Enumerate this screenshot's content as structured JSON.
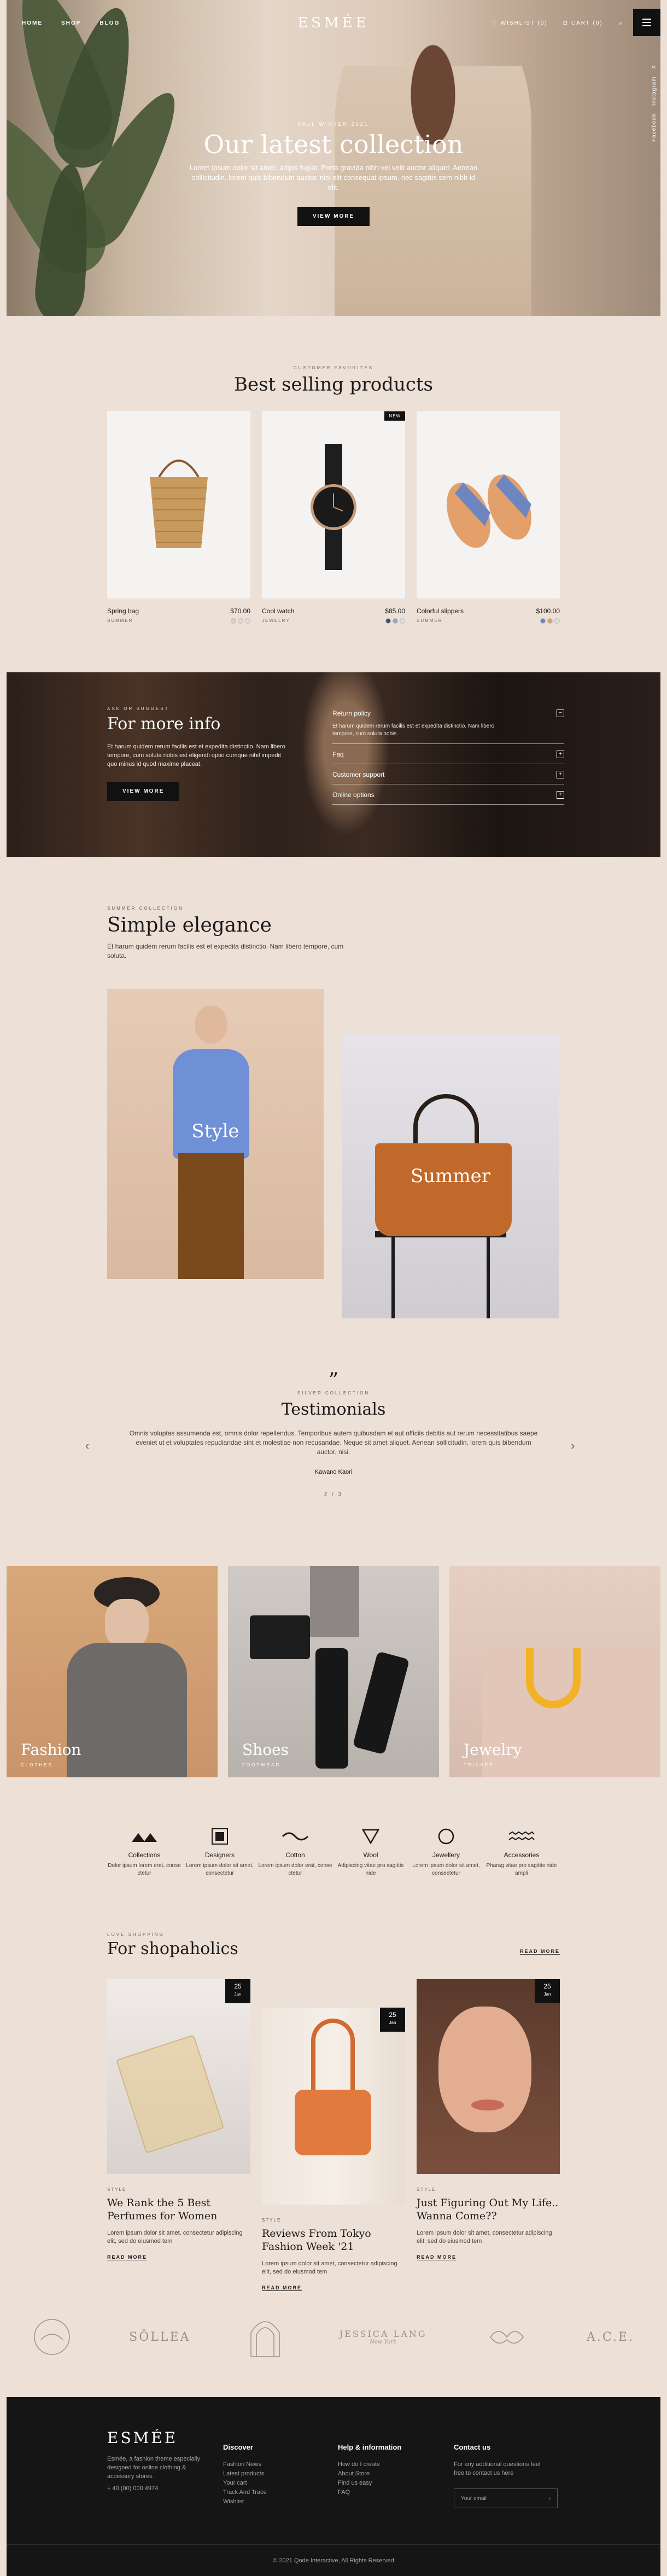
{
  "nav": {
    "links": [
      "HOME",
      "SHOP",
      "BLOG"
    ],
    "logo": "ESMÉE",
    "wishlist": "WISHLIST (0)",
    "cart": "CART (0)",
    "socials": [
      "Facebook",
      "Instagram",
      "X"
    ]
  },
  "hero": {
    "kicker": "FALL WINTER 2021",
    "title": "Our latest collection",
    "text": "Lorem ipsum dolor sit amet, adipis fugiat. Porta gravida nibh vel velit auctor aliquet. Aenean sollicitudin, lorem quis bibendum auctor, nisi elit consequat ipsum, nec sagittis sem nibh id elit.",
    "button": "VIEW MORE"
  },
  "best": {
    "kicker": "CUSTOMER FAVORITES",
    "title": "Best selling products",
    "products": [
      {
        "name": "Spring bag",
        "price": "$70.00",
        "category": "SUMMER",
        "tag": ""
      },
      {
        "name": "Cool watch",
        "price": "$85.00",
        "category": "JEWELRY",
        "tag": "NEW"
      },
      {
        "name": "Colorful slippers",
        "price": "$100.00",
        "category": "SUMMER",
        "tag": ""
      }
    ]
  },
  "banner": {
    "kicker": "ASK OR SUGGEST",
    "title": "For more info",
    "text": "Et harum quidem rerum facilis est et expedita distinctio. Nam libero tempore, cum soluta nobis est eligendi optio cumque nihil impedit quo minus id quod maxime placeat.",
    "button": "VIEW MORE",
    "accordion": [
      {
        "title": "Return policy",
        "body": "Et harum quidem rerum facilis est et expedita distinctio. Nam libero tempore, cum soluta nobis.",
        "open": true,
        "sign": "−"
      },
      {
        "title": "Faq",
        "body": "",
        "open": false,
        "sign": "+"
      },
      {
        "title": "Customer support",
        "body": "",
        "open": false,
        "sign": "+"
      },
      {
        "title": "Online options",
        "body": "",
        "open": false,
        "sign": "+"
      }
    ]
  },
  "elegance": {
    "kicker": "SUMMER COLLECTION",
    "title": "Simple elegance",
    "text": "Et harum quidem rerum facilis est et expedita distinctio. Nam libero tempore, cum soluta.",
    "tiles": [
      "Style",
      "Summer"
    ]
  },
  "testimonials": {
    "kicker": "SILVER COLLECTION",
    "title": "Testimonials",
    "text": "Omnis voluptas assumenda est, omnis dolor repellendus. Temporibus autem quibusdam et aut officiis debitis aut rerum necessitatibus saepe eveniet ut et voluptates repudiandae sint et molestiae non recusandae. Neque sit amet aliquet. Aenean sollicitudin, lorem quis bibendum auctor, nisi.",
    "author": "Kawano Kaori",
    "pagination": "2 / 3"
  },
  "categories": [
    {
      "label": "Fashion",
      "sub": "CLOTHES"
    },
    {
      "label": "Shoes",
      "sub": "FOOTWEAR"
    },
    {
      "label": "Jewelry",
      "sub": "TRINKET"
    }
  ],
  "features": [
    {
      "title": "Collections",
      "desc": "Dolor ipsum lorem erat, conse ctetur",
      "icon": "triangles-icon"
    },
    {
      "title": "Designers",
      "desc": "Lorem ipsum dolor sit amet, consectetur",
      "icon": "square-icon"
    },
    {
      "title": "Cotton",
      "desc": "Lorem ipsum dolor erat, conse ctetur",
      "icon": "wave-icon"
    },
    {
      "title": "Wool",
      "desc": "Adipiscing vitae pro sagittis nide",
      "icon": "triangle-down-icon"
    },
    {
      "title": "Jewellery",
      "desc": "Lorem ipsum dolor sit amet, consectetur",
      "icon": "circle-icon"
    },
    {
      "title": "Accessories",
      "desc": "Pharag vitae pro sagittis nide ampli",
      "icon": "zigzag-icon"
    }
  ],
  "blog": {
    "kicker": "LOVE SHOPPING",
    "title": "For shopaholics",
    "read_more": "READ MORE",
    "posts": [
      {
        "day": "25",
        "month": "Jan",
        "category": "STYLE",
        "title": "We Rank the 5 Best Perfumes for Women",
        "text": "Lorem ipsum dolor sit amet, consectetur adipiscing elit, sed do eiusmod tem",
        "link": "READ MORE"
      },
      {
        "day": "25",
        "month": "Jan",
        "category": "STYLE",
        "title": "Reviews From Tokyo Fashion Week '21",
        "text": "Lorem ipsum dolor sit amet, consectetur adipiscing elit, sed do eiusmod tem",
        "link": "READ MORE"
      },
      {
        "day": "25",
        "month": "Jan",
        "category": "STYLE",
        "title": "Just Figuring Out My Life.. Wanna Come??",
        "text": "Lorem ipsum dolor sit amet, consectetur adipiscing elit, sed do eiusmod tem",
        "link": "READ MORE"
      }
    ]
  },
  "brands": [
    "SÔLLEA",
    "JESSICA LANG",
    "New York",
    "A.C.E."
  ],
  "footer": {
    "logo": "ESMÉE",
    "about": "Esmée, a fashion theme especially designed for online clothing & accessory stores.",
    "phone": "+ 40 (00) 000 4974",
    "discover_title": "Discover",
    "discover": [
      "Fashion News",
      "Latest products",
      "Your cart",
      "Track And Trace",
      "Wishlist"
    ],
    "help_title": "Help & information",
    "help": [
      "How do I create",
      "About Store",
      "Find us easy",
      "FAQ"
    ],
    "contact_title": "Contact us",
    "contact_text": "For any additional questions feel free to contact us here",
    "email_placeholder": "Your email",
    "copyright": "© 2021 Qode Interactive, All Rights Reserved"
  }
}
